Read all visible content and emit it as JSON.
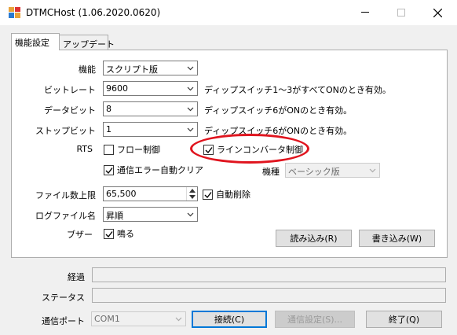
{
  "window": {
    "title": "DTMCHost (1.06.2020.0620)",
    "controls": {
      "minimize": "—",
      "maximize": "☐",
      "close": "✕"
    }
  },
  "tabs": [
    {
      "label": "機能設定",
      "active": true
    },
    {
      "label": "アップデート",
      "active": false
    }
  ],
  "settings": {
    "function": {
      "label": "機能",
      "value": "スクリプト版"
    },
    "bitrate": {
      "label": "ビットレート",
      "value": "9600",
      "note": "ディップスイッチ1～3がすべてONのとき有効。"
    },
    "databit": {
      "label": "データビット",
      "value": "8",
      "note": "ディップスイッチ6がONのとき有効。"
    },
    "stopbit": {
      "label": "ストップビット",
      "value": "1",
      "note": "ディップスイッチ6がONのとき有効。"
    },
    "rts": {
      "label": "RTS",
      "flow_control": {
        "label": "フロー制御",
        "checked": false
      },
      "line_converter": {
        "label": "ラインコンバータ制御",
        "checked": true
      }
    },
    "comm_error_autoclear": {
      "label": "通信エラー自動クリア",
      "checked": true
    },
    "model": {
      "label": "機種",
      "value": "ベーシック版"
    },
    "max_files": {
      "label": "ファイル数上限",
      "value": "65,500"
    },
    "auto_delete": {
      "label": "自動削除",
      "checked": true
    },
    "log_filename": {
      "label": "ログファイル名",
      "value": "昇順"
    },
    "buzzer": {
      "label": "ブザー",
      "checkbox_label": "鳴る",
      "checked": true
    },
    "load_button": "読み込み(R)",
    "write_button": "書き込み(W)"
  },
  "status": {
    "elapsed_label": "経過",
    "elapsed_value": "",
    "status_label": "ステータス",
    "status_value": ""
  },
  "footer": {
    "port_label": "通信ポート",
    "port_value": "COM1",
    "connect_button": "接続(C)",
    "comm_settings_button": "通信設定(S)...",
    "exit_button": "終了(Q)"
  },
  "colors": {
    "annotation": "#e0141e",
    "focus_blue": "#0078d7"
  }
}
